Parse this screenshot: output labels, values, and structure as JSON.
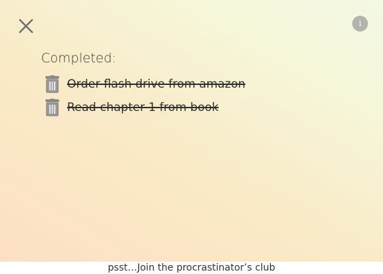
{
  "header": {
    "close_icon": "close-icon",
    "info_label": "i"
  },
  "completed": {
    "title": "Completed:",
    "items": [
      {
        "text": "Order flash drive from amazon",
        "icon": "trash-icon"
      },
      {
        "text": "Read chapter 1 from book",
        "icon": "trash-icon"
      }
    ]
  },
  "footer": {
    "text": "psst…Join the procrastinator’s club"
  },
  "colors": {
    "icon_gray": "#7a7a7a",
    "info_bg": "#b3b3ab"
  }
}
